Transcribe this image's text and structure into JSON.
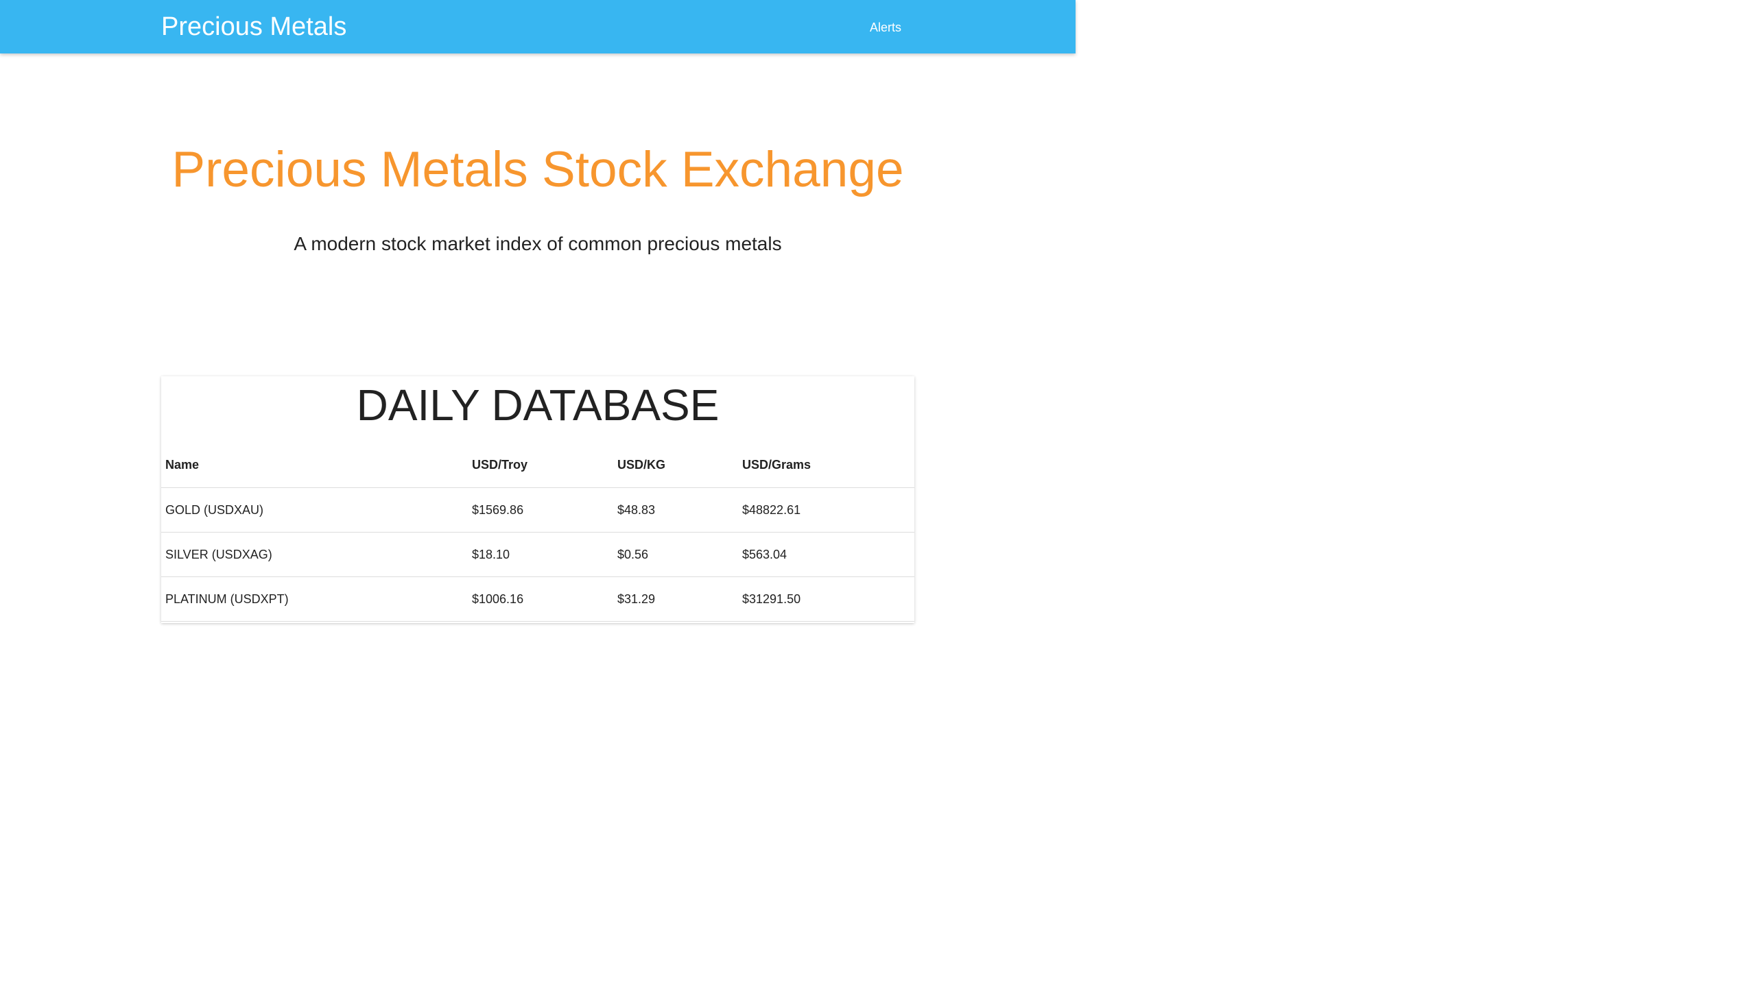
{
  "navbar": {
    "brand": "Precious Metals",
    "links": [
      "Alerts"
    ]
  },
  "hero": {
    "title": "Precious Metals Stock Exchange",
    "subtitle": "A modern stock market index of common precious metals"
  },
  "database": {
    "title": "DAILY DATABASE",
    "columns": [
      "Name",
      "USD/Troy",
      "USD/KG",
      "USD/Grams"
    ],
    "rows": [
      [
        "GOLD (USDXAU)",
        "$1569.86",
        "$48.83",
        "$48822.61"
      ],
      [
        "SILVER (USDXAG)",
        "$18.10",
        "$0.56",
        "$563.04"
      ],
      [
        "PLATINUM (USDXPT)",
        "$1006.16",
        "$31.29",
        "$31291.50"
      ]
    ]
  },
  "colors": {
    "navbar": "#38b6f1",
    "hero_title": "#f7962e",
    "text": "#222222"
  }
}
